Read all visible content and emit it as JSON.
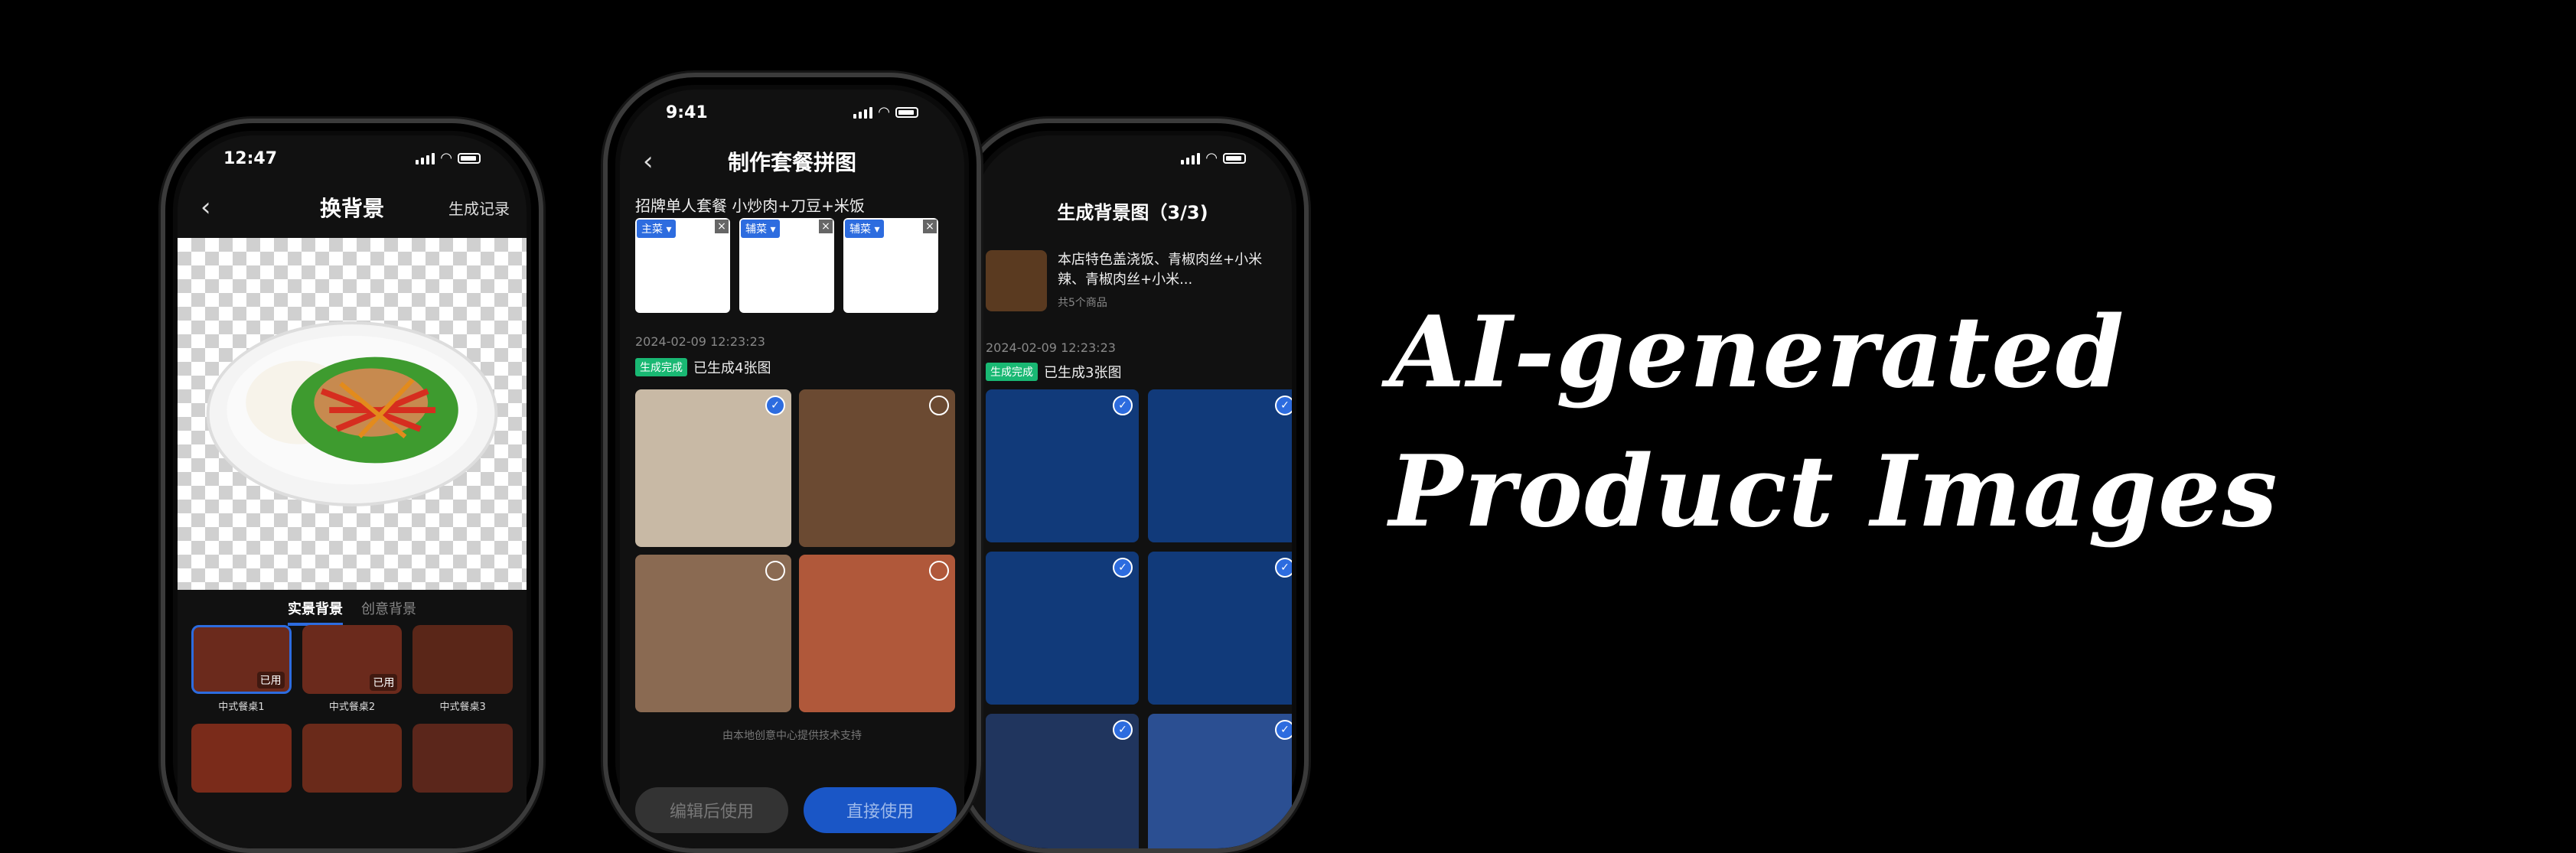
{
  "colors": {
    "bg": "#000000",
    "accent": "#2d6cdf",
    "success": "#19b873"
  },
  "phone1": {
    "time": "12:47",
    "title": "换背景",
    "right_action": "生成记录",
    "tabs": [
      "实景背景",
      "创意背景"
    ],
    "thumbs": [
      {
        "label": "中式餐桌1",
        "badge": "已用"
      },
      {
        "label": "中式餐桌2",
        "badge": "已用"
      },
      {
        "label": "中式餐桌3",
        "badge": ""
      }
    ]
  },
  "phone2": {
    "time": "9:41",
    "title": "制作套餐拼图",
    "subtitle": "招牌单人套餐 小炒肉+刀豆+米饭",
    "chips": [
      {
        "tag": "主菜 ▾",
        "close": "×"
      },
      {
        "tag": "辅菜 ▾",
        "close": "×"
      },
      {
        "tag": "辅菜 ▾",
        "close": "×"
      }
    ],
    "timestamp": "2024-02-09 12:23:23",
    "status_badge": "生成完成",
    "status_text": "已生成4张图",
    "footer_note": "由本地创意中心提供技术支持",
    "btn_secondary": "编辑后使用",
    "btn_primary": "直接使用"
  },
  "phone3": {
    "title": "生成背景图（3/3)",
    "product_title": "本店特色盖浇饭、青椒肉丝+小米辣、青椒肉丝+小米...",
    "product_count": "共5个商品",
    "timestamp": "2024-02-09 12:23:23",
    "status_badge": "生成完成",
    "status_text": "已生成3张图"
  },
  "headline": {
    "line1": "AI-generated",
    "line2": "Product Images"
  }
}
